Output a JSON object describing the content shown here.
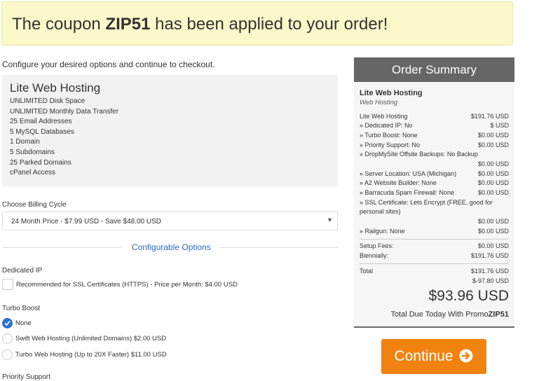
{
  "banner": {
    "prefix": "The coupon ",
    "code": "ZIP51",
    "suffix": " has been applied to your order!"
  },
  "intro_text": "Configure your desired options and continue to checkout.",
  "product": {
    "name": "Lite Web Hosting",
    "features": [
      "UNLIMITED Disk Space",
      "UNLIMITED Monthly Data Transfer",
      "25 Email Addresses",
      "5 MySQL Databases",
      "1 Domain",
      "5 Subdomains",
      "25 Parked Domains",
      "cPanel Access"
    ]
  },
  "billing": {
    "label": "Choose Billing Cycle",
    "selected": "24 Month Price - $7.99 USD - Save $48.00 USD"
  },
  "configurable_options_title": "Configurable Options",
  "dedicated_ip": {
    "label": "Dedicated IP",
    "checkbox_label": "Recommended for SSL Certificates (HTTPS) - Price per Month: $4.00 USD",
    "checked": false
  },
  "turbo_boost": {
    "label": "Turbo Boost",
    "options": [
      {
        "label": "None",
        "selected": true
      },
      {
        "label": "Swift Web Hosting (Unlimited Domains) $2.00 USD",
        "selected": false
      },
      {
        "label": "Turbo Web Hosting (Up to 20X Faster) $11.00 USD",
        "selected": false
      }
    ]
  },
  "next_section_partial": "Priority Support",
  "summary": {
    "header": "Order Summary",
    "product_name": "Lite Web Hosting",
    "product_group": "Web Hosting",
    "rows": [
      {
        "label": "Lite Web Hosting",
        "value": "$191.76 USD"
      },
      {
        "label": "» Dedicated IP: No",
        "value": "$ USD"
      },
      {
        "label": "» Turbo Boost: None",
        "value": "$0.00 USD"
      },
      {
        "label": "» Priority Support: No",
        "value": "$0.00 USD"
      }
    ],
    "dropmysite_label": "» DropMySite Offsite Backups: No Backup",
    "dropmysite_value": "$0.00 USD",
    "rows2": [
      {
        "label": "» Server Location: USA (Michigan)",
        "value": "$0.00 USD"
      },
      {
        "label": "» A2 Website Builder: None",
        "value": "$0.00 USD"
      },
      {
        "label": "» Barracuda Spam Firewall: None",
        "value": "$0.00 USD"
      }
    ],
    "ssl_label": "» SSL Certificate: Lets Encrypt (FREE, good for personal sites)",
    "ssl_value": "$0.00 USD",
    "railgun_label": "» Railgun: None",
    "railgun_value": "$0.00 USD",
    "setup_fees_label": "Setup Fees:",
    "setup_fees_value": "$0.00 USD",
    "biennially_label": "Biennially:",
    "biennially_value": "$191.76 USD",
    "total_label": "Total",
    "total_value": "$191.76 USD",
    "discount_value": "$-97.80 USD",
    "total_due": "$93.96 USD",
    "due_today_prefix": "Total Due Today With Promo",
    "due_today_code": "ZIP51"
  },
  "continue_label": "Continue",
  "colors": {
    "banner_bg": "#fbf9c9",
    "accent_blue": "#2a73d4",
    "continue_orange": "#f0820f",
    "summary_header": "#666666"
  }
}
